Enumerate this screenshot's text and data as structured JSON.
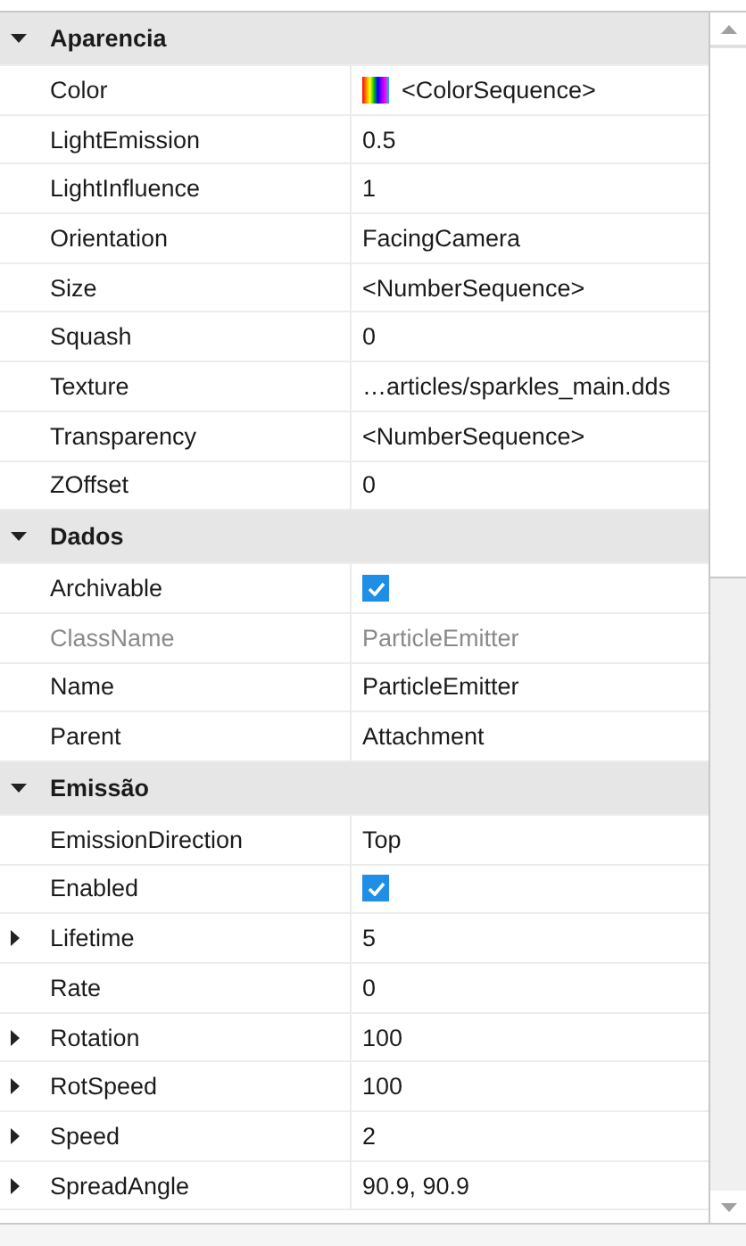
{
  "sections": [
    {
      "title": "Aparencia",
      "expanded": true,
      "properties": [
        {
          "name": "Color",
          "kind": "color-sequence",
          "value": "<ColorSequence>",
          "disabled": false,
          "expandable": false
        },
        {
          "name": "LightEmission",
          "kind": "text",
          "value": "0.5",
          "disabled": false,
          "expandable": false
        },
        {
          "name": "LightInfluence",
          "kind": "text",
          "value": "1",
          "disabled": false,
          "expandable": false
        },
        {
          "name": "Orientation",
          "kind": "text",
          "value": "FacingCamera",
          "disabled": false,
          "expandable": false
        },
        {
          "name": "Size",
          "kind": "text",
          "value": "<NumberSequence>",
          "disabled": false,
          "expandable": false
        },
        {
          "name": "Squash",
          "kind": "text",
          "value": "0",
          "disabled": false,
          "expandable": false
        },
        {
          "name": "Texture",
          "kind": "text",
          "value": "…articles/sparkles_main.dds",
          "disabled": false,
          "expandable": false
        },
        {
          "name": "Transparency",
          "kind": "text",
          "value": "<NumberSequence>",
          "disabled": false,
          "expandable": false
        },
        {
          "name": "ZOffset",
          "kind": "text",
          "value": "0",
          "disabled": false,
          "expandable": false
        }
      ]
    },
    {
      "title": "Dados",
      "expanded": true,
      "properties": [
        {
          "name": "Archivable",
          "kind": "checkbox",
          "checked": true,
          "disabled": false,
          "expandable": false
        },
        {
          "name": "ClassName",
          "kind": "text",
          "value": "ParticleEmitter",
          "disabled": true,
          "expandable": false
        },
        {
          "name": "Name",
          "kind": "text",
          "value": "ParticleEmitter",
          "disabled": false,
          "expandable": false
        },
        {
          "name": "Parent",
          "kind": "text",
          "value": "Attachment",
          "disabled": false,
          "expandable": false
        }
      ]
    },
    {
      "title": "Emissão",
      "expanded": true,
      "properties": [
        {
          "name": "EmissionDirection",
          "kind": "text",
          "value": "Top",
          "disabled": false,
          "expandable": false
        },
        {
          "name": "Enabled",
          "kind": "checkbox",
          "checked": true,
          "disabled": false,
          "expandable": false
        },
        {
          "name": "Lifetime",
          "kind": "text",
          "value": "5",
          "disabled": false,
          "expandable": true
        },
        {
          "name": "Rate",
          "kind": "text",
          "value": "0",
          "disabled": false,
          "expandable": false
        },
        {
          "name": "Rotation",
          "kind": "text",
          "value": "100",
          "disabled": false,
          "expandable": true
        },
        {
          "name": "RotSpeed",
          "kind": "text",
          "value": "100",
          "disabled": false,
          "expandable": true
        },
        {
          "name": "Speed",
          "kind": "text",
          "value": "2",
          "disabled": false,
          "expandable": true
        },
        {
          "name": "SpreadAngle",
          "kind": "text",
          "value": "90.9, 90.9",
          "disabled": false,
          "expandable": true
        }
      ]
    }
  ]
}
